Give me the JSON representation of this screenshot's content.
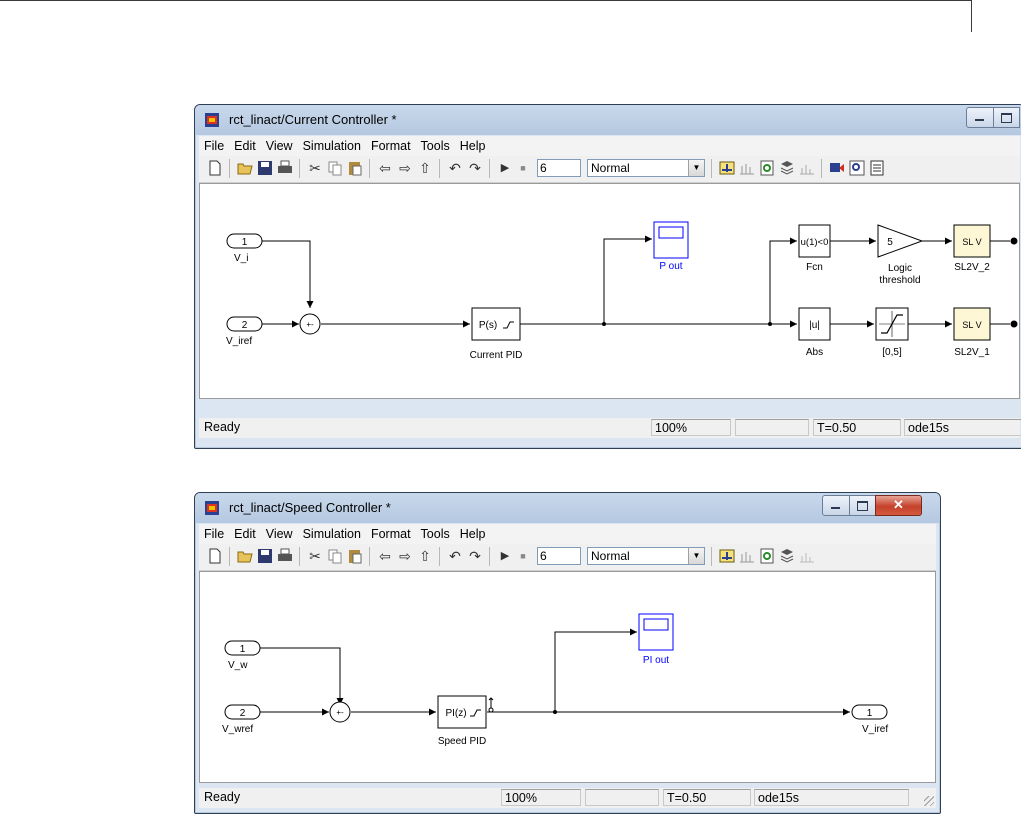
{
  "windows": [
    {
      "title": "rct_linact/Current Controller *",
      "menus": [
        "File",
        "Edit",
        "View",
        "Simulation",
        "Format",
        "Tools",
        "Help"
      ],
      "stop_time": "6",
      "sim_mode": "Normal",
      "status": {
        "state": "Ready",
        "zoom": "100%",
        "time": "T=0.50",
        "solver": "ode15s"
      },
      "blocks": {
        "in1_num": "1",
        "in1_name": "V_i",
        "in2_num": "2",
        "in2_name": "V_iref",
        "sum_signs": "+-",
        "pid_text": "P(s)",
        "pid_name": "Current PID",
        "scope_name": "P out",
        "fcn_text": "u(1)<0",
        "fcn_name": "Fcn",
        "gain_text": "5",
        "gain_name1": "Logic",
        "gain_name2": "threshold",
        "abs_text": "|u|",
        "abs_name": "Abs",
        "sat_name": "[0,5]",
        "sl2v_text": "SL  V",
        "sl2v2_name": "SL2V_2",
        "sl2v1_name": "SL2V_1"
      }
    },
    {
      "title": "rct_linact/Speed Controller *",
      "menus": [
        "File",
        "Edit",
        "View",
        "Simulation",
        "Format",
        "Tools",
        "Help"
      ],
      "stop_time": "6",
      "sim_mode": "Normal",
      "status": {
        "state": "Ready",
        "zoom": "100%",
        "time": "T=0.50",
        "solver": "ode15s"
      },
      "blocks": {
        "in1_num": "1",
        "in1_name": "V_w",
        "in2_num": "2",
        "in2_name": "V_wref",
        "sum_signs": "+-",
        "pid_text": "PI(z)",
        "pid_name": "Speed PID",
        "scope_name": "PI out",
        "out_num": "1",
        "out_name": "V_iref"
      }
    }
  ],
  "icons": {
    "new": "new-model-icon",
    "open": "open-icon",
    "save": "save-icon",
    "print": "print-icon",
    "cut": "cut-icon",
    "copy": "copy-icon",
    "paste": "paste-icon",
    "back": "back-arrow-icon",
    "forward": "forward-arrow-icon",
    "up": "up-arrow-icon",
    "undo": "undo-icon",
    "redo": "redo-icon",
    "run": "run-icon",
    "stop": "stop-icon"
  },
  "colors": {
    "scope_blue": "#0000ff",
    "sl2v_fill": "#fdf7d6",
    "close_red": "#c5412b",
    "window_frame": "#dbe6f2"
  }
}
